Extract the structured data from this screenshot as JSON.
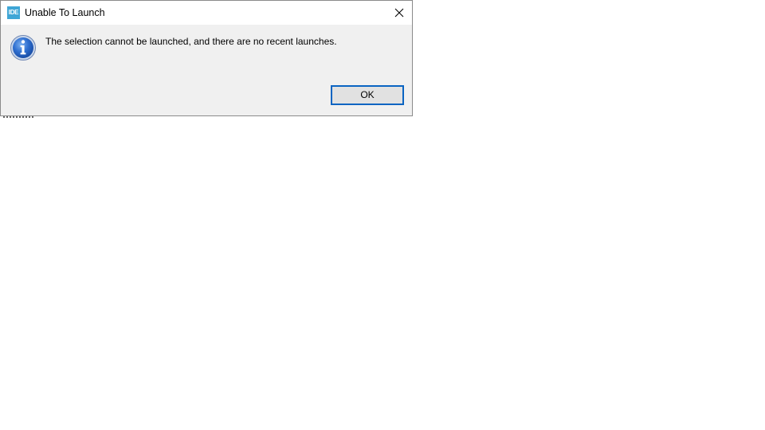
{
  "dialog": {
    "app_icon_text": "IDE",
    "title": "Unable To Launch",
    "message": "The selection cannot be launched, and there are no recent launches.",
    "ok_label": "OK",
    "icons": {
      "app": "ide-app-icon",
      "close": "close-icon",
      "info": "info-icon"
    },
    "colors": {
      "app_icon": "#3fa6d6",
      "button_focus_border": "#0a64c2",
      "dialog_background": "#f0f0f0"
    }
  }
}
